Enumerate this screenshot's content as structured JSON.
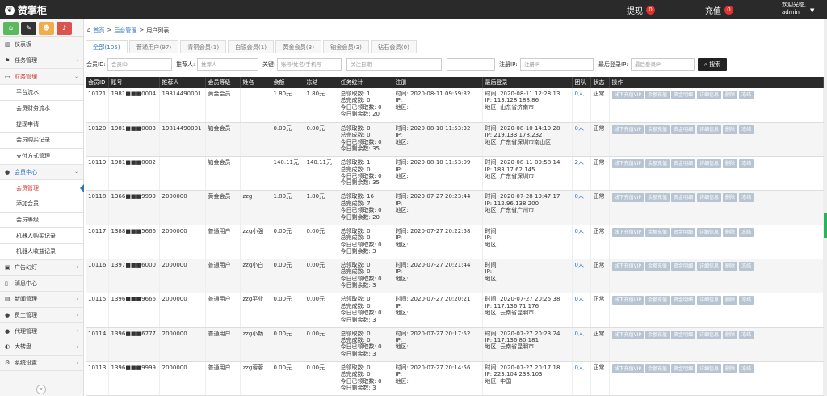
{
  "topbar": {
    "logo": "赞掌柜",
    "withdraw_label": "提现",
    "withdraw_count": "0",
    "recharge_label": "充值",
    "recharge_count": "0",
    "welcome": "欢迎光临,",
    "username": "admin"
  },
  "sidebar": {
    "items": [
      {
        "label": "仪表板",
        "name": "dashboard",
        "icon": "▥"
      },
      {
        "label": "任务管理",
        "name": "task",
        "icon": "⚑",
        "chev": "‹"
      },
      {
        "label": "财务管理",
        "name": "finance",
        "icon": "▭",
        "chev": "⌄",
        "open": true
      },
      {
        "label": "平台流水",
        "name": "platform-flow",
        "sub": true
      },
      {
        "label": "会员财务流水",
        "name": "member-finance-flow",
        "sub": true
      },
      {
        "label": "提现申请",
        "name": "withdraw-request",
        "sub": true
      },
      {
        "label": "会员购买记录",
        "name": "member-purchase",
        "sub": true
      },
      {
        "label": "支付方式管理",
        "name": "payment-methods",
        "sub": true
      },
      {
        "label": "会员中心",
        "name": "member-center",
        "icon": "●",
        "chev": "⌄",
        "blue": true
      },
      {
        "label": "会员管理",
        "name": "member-manage",
        "sub": true,
        "active": true
      },
      {
        "label": "添加会员",
        "name": "add-member",
        "sub": true
      },
      {
        "label": "会员等级",
        "name": "member-level",
        "sub": true
      },
      {
        "label": "机器人购买记录",
        "name": "robot-purchase",
        "sub": true
      },
      {
        "label": "机器人收益记录",
        "name": "robot-income",
        "sub": true
      },
      {
        "label": "广告幻灯",
        "name": "ad-slides",
        "icon": "▣",
        "chev": "‹"
      },
      {
        "label": "消息中心",
        "name": "message-center",
        "icon": "▯"
      },
      {
        "label": "新闻管理",
        "name": "news",
        "icon": "▤",
        "chev": "‹"
      },
      {
        "label": "员工管理",
        "name": "staff",
        "icon": "●",
        "chev": "‹"
      },
      {
        "label": "代理管理",
        "name": "agent",
        "icon": "●",
        "chev": "‹"
      },
      {
        "label": "大转盘",
        "name": "wheel",
        "icon": "◐",
        "chev": "‹"
      },
      {
        "label": "系统设置",
        "name": "settings",
        "icon": "⚙",
        "chev": "‹"
      }
    ]
  },
  "breadcrumb": {
    "home": "首页",
    "sep": ">",
    "section": "后台管理",
    "page": "用户列表"
  },
  "tabs": [
    {
      "label": "全部(105)",
      "active": true
    },
    {
      "label": "普通用户(97)"
    },
    {
      "label": "青铜会员(1)"
    },
    {
      "label": "白银会员(1)"
    },
    {
      "label": "黄金会员(3)"
    },
    {
      "label": "铂金会员(3)"
    },
    {
      "label": "钻石会员(0)"
    }
  ],
  "filters": {
    "member_id_label": "会员ID:",
    "member_id_ph": "会员ID",
    "referrer_label": "推荐人:",
    "referrer_ph": "推荐人",
    "account_label": "关键:",
    "account_ph": "账号/姓名/手机号",
    "date_ph": "关注日期",
    "ip_label": "注册IP:",
    "ip_ph": "注册IP",
    "last_ip_label": "最后登录IP:",
    "last_ip_ph": "最后登录IP",
    "search_label": "搜索"
  },
  "table": {
    "headers": [
      "会员ID",
      "账号",
      "推荐人",
      "会员等级",
      "姓名",
      "余额",
      "冻结",
      "任务统计",
      "注册",
      "最后登录",
      "团队",
      "状态",
      "操作"
    ],
    "ops": [
      "线下充值VIP",
      "余额充值",
      "资金明细",
      "详细信息",
      "删除",
      "冻结"
    ],
    "rows": [
      {
        "id": "10121",
        "account": "1981■■■0004",
        "referrer": "19814490001",
        "level": "黄金会员",
        "name": "",
        "balance": "1.80元",
        "frozen": "1.80元",
        "t1": "总领取数: 1",
        "t2": "总完成数: 0",
        "t3": "今日已领取数: 0",
        "t4": "今日剩余数: 20",
        "r1": "时间: 2020-08-11 09:59:32",
        "r2": "IP:",
        "r3": "地区:",
        "l1": "时间: 2020-08-11 12:28:13",
        "l2": "IP: 113.128.188.86",
        "l3": "地区: 山东省济南市",
        "team": "0人",
        "status": "正常"
      },
      {
        "id": "10120",
        "account": "1981■■■0003",
        "referrer": "19814490001",
        "level": "铂金会员",
        "name": "",
        "balance": "0.00元",
        "frozen": "0.00元",
        "t1": "总领取数: 0",
        "t2": "总完成数: 0",
        "t3": "今日已领取数: 0",
        "t4": "今日剩余数: 35",
        "r1": "时间: 2020-08-10 11:53:32",
        "r2": "IP:",
        "r3": "地区:",
        "l1": "时间: 2020-08-10 14:19:28",
        "l2": "IP: 219.133.178.232",
        "l3": "地区: 广东省深圳市南山区",
        "team": "0人",
        "status": "正常"
      },
      {
        "id": "10119",
        "account": "1981■■■0002",
        "referrer": "",
        "level": "铂金会员",
        "name": "",
        "balance": "140.11元",
        "frozen": "140.11元",
        "t1": "总领取数: 1",
        "t2": "总完成数: 0",
        "t3": "今日已领取数: 0",
        "t4": "今日剩余数: 35",
        "r1": "时间: 2020-08-10 11:53:09",
        "r2": "IP:",
        "r3": "地区:",
        "l1": "时间: 2020-08-11 09:58:14",
        "l2": "IP: 183.17.62.145",
        "l3": "地区: 广东省深圳市",
        "team": "2人",
        "status": "正常"
      },
      {
        "id": "10118",
        "account": "1366■■■9999",
        "referrer": "2000000",
        "level": "黄金会员",
        "name": "zzg",
        "balance": "1.80元",
        "frozen": "1.80元",
        "t1": "总领取数: 16",
        "t2": "总完成数: 7",
        "t3": "今日已领取数: 0",
        "t4": "今日剩余数: 20",
        "r1": "时间: 2020-07-27 20:23:44",
        "r2": "IP:",
        "r3": "地区:",
        "l1": "时间: 2020-07-28 19:47:17",
        "l2": "IP: 112.96.138.200",
        "l3": "地区: 广东省广州市",
        "team": "0人",
        "status": "正常"
      },
      {
        "id": "10117",
        "account": "1388■■■5666",
        "referrer": "2000000",
        "level": "普通用户",
        "name": "zzg小强",
        "balance": "0.00元",
        "frozen": "0.00元",
        "t1": "总领取数: 0",
        "t2": "总完成数: 0",
        "t3": "今日已领取数: 0",
        "t4": "今日剩余数: 3",
        "r1": "时间: 2020-07-27 20:22:58",
        "r2": "IP:",
        "r3": "地区:",
        "l1": "时间:",
        "l2": "IP:",
        "l3": "地区:",
        "team": "0人",
        "status": "正常"
      },
      {
        "id": "10116",
        "account": "1397■■■6000",
        "referrer": "2000000",
        "level": "普通用户",
        "name": "zzg小白",
        "balance": "0.00元",
        "frozen": "0.00元",
        "t1": "总领取数: 0",
        "t2": "总完成数: 0",
        "t3": "今日已领取数: 0",
        "t4": "今日剩余数: 3",
        "r1": "时间: 2020-07-27 20:21:44",
        "r2": "IP:",
        "r3": "地区:",
        "l1": "时间:",
        "l2": "IP:",
        "l3": "地区:",
        "team": "0人",
        "status": "正常"
      },
      {
        "id": "10115",
        "account": "1396■■■9666",
        "referrer": "2000000",
        "level": "普通用户",
        "name": "zzg平业",
        "balance": "0.00元",
        "frozen": "0.00元",
        "t1": "总领取数: 0",
        "t2": "总完成数: 0",
        "t3": "今日已领取数: 0",
        "t4": "今日剩余数: 3",
        "r1": "时间: 2020-07-27 20:20:21",
        "r2": "IP:",
        "r3": "地区:",
        "l1": "时间: 2020-07-27 20:25:38",
        "l2": "IP: 117.136.71.176",
        "l3": "地区: 云南省昆明市",
        "team": "0人",
        "status": "正常"
      },
      {
        "id": "10114",
        "account": "1396■■■6777",
        "referrer": "2000000",
        "level": "普通用户",
        "name": "zzg小畅",
        "balance": "0.00元",
        "frozen": "0.00元",
        "t1": "总领取数: 0",
        "t2": "总完成数: 0",
        "t3": "今日已领取数: 0",
        "t4": "今日剩余数: 3",
        "r1": "时间: 2020-07-27 20:17:52",
        "r2": "IP:",
        "r3": "地区:",
        "l1": "时间: 2020-07-27 20:23:24",
        "l2": "IP: 117.136.80.181",
        "l3": "地区: 云南省昆明市",
        "team": "0人",
        "status": "正常"
      },
      {
        "id": "10113",
        "account": "1396■■■9999",
        "referrer": "2000000",
        "level": "普通用户",
        "name": "zzg蓉蓉",
        "balance": "0.00元",
        "frozen": "0.00元",
        "t1": "总领取数: 0",
        "t2": "总完成数: 0",
        "t3": "今日已领取数: 0",
        "t4": "今日剩余数: 3",
        "r1": "时间: 2020-07-27 20:14:56",
        "r2": "IP:",
        "r3": "地区:",
        "l1": "时间: 2020-07-27 20:17:18",
        "l2": "IP: 223.104.238.103",
        "l3": "地区: 中国",
        "team": "0人",
        "status": "正常"
      }
    ]
  },
  "colors": {
    "accent_red": "#d0342c",
    "accent_blue": "#2b74c0",
    "sc_green": "#5cb85c",
    "sc_dark": "#333333",
    "sc_orange": "#f0ad4e",
    "sc_red": "#d9534f"
  }
}
